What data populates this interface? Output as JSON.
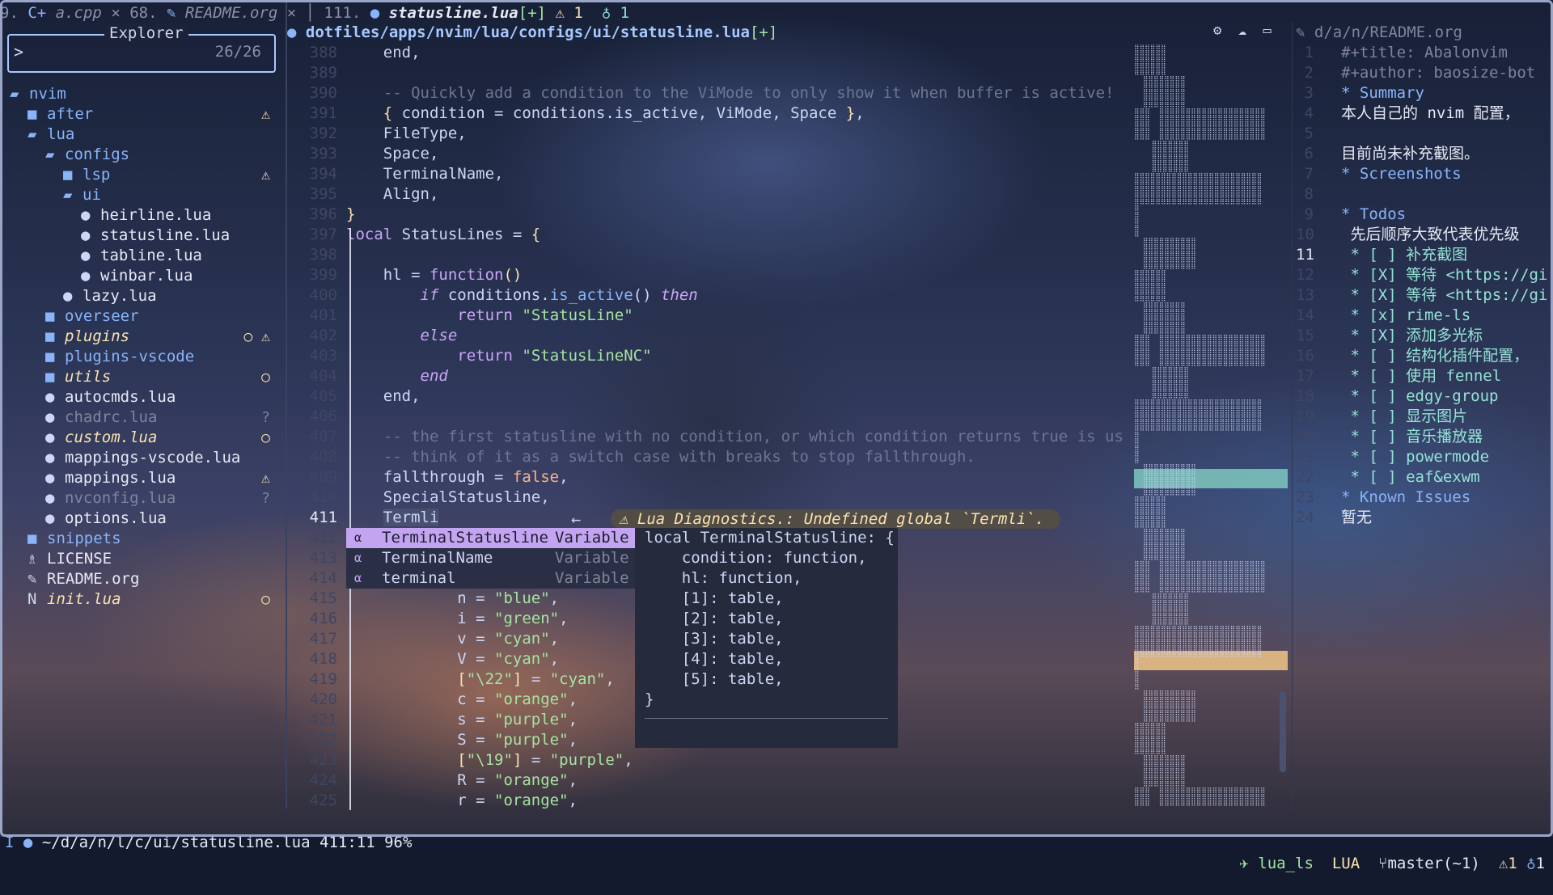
{
  "tabs": {
    "left_partial": "9. ",
    "tab1_icon": "c++-icon",
    "tab1_label": "a.cpp",
    "tab1_close": "×",
    "tab2_num": "68.",
    "tab2_label": "README.org",
    "tab2_close": "×",
    "tab3_num": "111.",
    "tab3_label": "statusline.lua",
    "tab3_mod": "[+]",
    "warn_count": "1",
    "hint_count": "1"
  },
  "explorer": {
    "title": "Explorer",
    "prompt": ">",
    "count": "26/26",
    "items": [
      {
        "label": "nvim",
        "icon": "folder-open-icon",
        "badge": ""
      },
      {
        "label": "after",
        "icon": "folder-icon",
        "badge": "⚠"
      },
      {
        "label": "lua",
        "icon": "folder-open-icon",
        "badge": ""
      },
      {
        "label": "configs",
        "icon": "folder-open-icon",
        "badge": ""
      },
      {
        "label": "lsp",
        "icon": "folder-icon",
        "badge": "⚠"
      },
      {
        "label": "ui",
        "icon": "folder-open-icon",
        "badge": ""
      },
      {
        "label": "heirline.lua",
        "icon": "lua-icon",
        "badge": ""
      },
      {
        "label": "statusline.lua",
        "icon": "lua-icon",
        "badge": ""
      },
      {
        "label": "tabline.lua",
        "icon": "lua-icon",
        "badge": ""
      },
      {
        "label": "winbar.lua",
        "icon": "lua-icon",
        "badge": ""
      },
      {
        "label": "lazy.lua",
        "icon": "lua-icon",
        "badge": ""
      },
      {
        "label": "overseer",
        "icon": "folder-icon",
        "badge": ""
      },
      {
        "label": "plugins",
        "icon": "folder-icon",
        "badge": "○ ⚠"
      },
      {
        "label": "plugins-vscode",
        "icon": "folder-icon",
        "badge": ""
      },
      {
        "label": "utils",
        "icon": "folder-icon",
        "badge": "○"
      },
      {
        "label": "autocmds.lua",
        "icon": "lua-icon",
        "badge": ""
      },
      {
        "label": "chadrc.lua",
        "icon": "lua-icon",
        "badge": "?"
      },
      {
        "label": "custom.lua",
        "icon": "lua-icon",
        "badge": "○"
      },
      {
        "label": "mappings-vscode.lua",
        "icon": "lua-icon",
        "badge": ""
      },
      {
        "label": "mappings.lua",
        "icon": "lua-icon",
        "badge": "⚠"
      },
      {
        "label": "nvconfig.lua",
        "icon": "lua-icon",
        "badge": "?"
      },
      {
        "label": "options.lua",
        "icon": "lua-icon",
        "badge": ""
      },
      {
        "label": "snippets",
        "icon": "folder-icon",
        "badge": ""
      },
      {
        "label": "LICENSE",
        "icon": "license-icon",
        "badge": ""
      },
      {
        "label": "README.org",
        "icon": "org-icon",
        "badge": ""
      },
      {
        "label": "init.lua",
        "icon": "neovim-icon",
        "badge": "○"
      }
    ]
  },
  "editor": {
    "path": "dotfiles/apps/nvim/lua/configs/ui/statusline.lua",
    "path_mod": "[+]",
    "line_numbers": [
      "388",
      "389",
      "390",
      "391",
      "392",
      "393",
      "394",
      "395",
      "396",
      "397",
      "398",
      "399",
      "400",
      "401",
      "402",
      "403",
      "404",
      "405",
      "406",
      "407",
      "408",
      "409",
      "410",
      "411",
      "412",
      "413",
      "414",
      "415",
      "416",
      "417",
      "418",
      "419",
      "420",
      "421",
      "422",
      "423",
      "424",
      "425"
    ],
    "current_line": "411",
    "diagnostic": "⚠ Lua Diagnostics.: Undefined global `Termli`.",
    "back_arrow": "←"
  },
  "completion": {
    "items": [
      {
        "kind": "α",
        "word": "TerminalStatusline",
        "type": "Variable"
      },
      {
        "kind": "α",
        "word": "TerminalName",
        "type": "Variable"
      },
      {
        "kind": "α",
        "word": "terminal",
        "type": "Variable"
      }
    ],
    "doc": [
      "local TerminalStatusline: {",
      "    condition: function,",
      "    hl: function,",
      "    [1]: table,",
      "    [2]: table,",
      "    [3]: table,",
      "    [4]: table,",
      "    [5]: table,",
      "}"
    ]
  },
  "readme": {
    "path": "d/a/n/README.org",
    "current_line": "11",
    "lines": [
      {
        "n": "1",
        "text": "#+title: Abalonvim"
      },
      {
        "n": "2",
        "text": "#+author: baosize-bot"
      },
      {
        "n": "3",
        "text": "* Summary"
      },
      {
        "n": "4",
        "text": "本人自己的 nvim 配置，"
      },
      {
        "n": "5",
        "text": ""
      },
      {
        "n": "6",
        "text": "目前尚未补充截图。"
      },
      {
        "n": "7",
        "text": "* Screenshots"
      },
      {
        "n": "8",
        "text": ""
      },
      {
        "n": "9",
        "text": "* Todos"
      },
      {
        "n": "10",
        "text": " 先后顺序大致代表优先级"
      },
      {
        "n": "11",
        "text": " * [ ] 补充截图"
      },
      {
        "n": "12",
        "text": " * [X] 等待 <https://gi"
      },
      {
        "n": "13",
        "text": " * [X] 等待 <https://gi"
      },
      {
        "n": "14",
        "text": " * [x] rime-ls"
      },
      {
        "n": "15",
        "text": " * [X] 添加多光标"
      },
      {
        "n": "16",
        "text": " * [ ] 结构化插件配置，"
      },
      {
        "n": "17",
        "text": " * [ ] 使用 fennel"
      },
      {
        "n": "18",
        "text": " * [ ] edgy-group"
      },
      {
        "n": "19",
        "text": " * [ ] 显示图片"
      },
      {
        "n": "20",
        "text": " * [ ] 音乐播放器"
      },
      {
        "n": "21",
        "text": " * [ ] powermode"
      },
      {
        "n": "22",
        "text": " * [ ] eaf&exwm"
      },
      {
        "n": "23",
        "text": "* Known Issues"
      },
      {
        "n": "24",
        "text": "暂无"
      }
    ]
  },
  "status": {
    "mode": "I",
    "file": "~/d/a/n/l/c/ui/statusline.lua",
    "position": "411:11",
    "percent": "96%",
    "lsp": "lua_ls",
    "filetype": "LUA",
    "branch": "master(~1)",
    "warn": "1",
    "hint": "1"
  },
  "colors": {
    "accent": "#a6c8ff",
    "selection": "#c3a4f0",
    "warning": "#f9e2af",
    "string": "#a6e3a1",
    "keyword": "#cba6f7"
  }
}
